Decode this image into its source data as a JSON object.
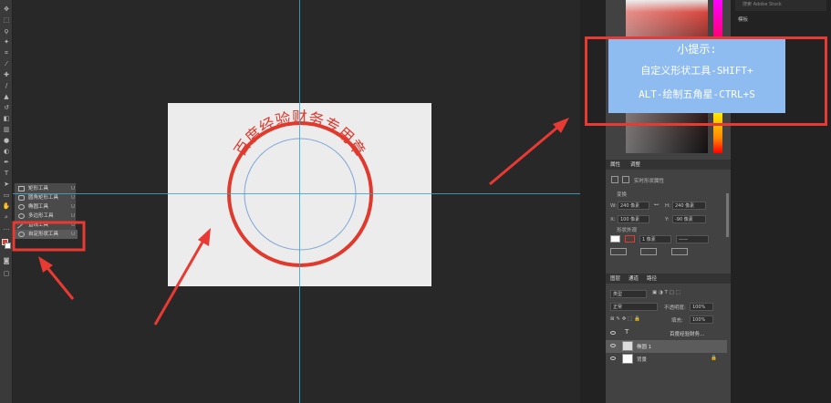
{
  "tip": {
    "title": "小提示:",
    "line1": "自定义形状工具-SHIFT+",
    "line2": "ALT-绘制五角星-CTRL+S"
  },
  "stamp": {
    "text": "百度经验财务专用章",
    "color": "#e03a2e"
  },
  "flyout": {
    "items": [
      {
        "label": "矩形工具",
        "shortcut": "U"
      },
      {
        "label": "圆角矩形工具",
        "shortcut": "U"
      },
      {
        "label": "椭圆工具",
        "shortcut": "U"
      },
      {
        "label": "多边形工具",
        "shortcut": "U"
      },
      {
        "label": "直线工具",
        "shortcut": "U"
      },
      {
        "label": "自定形状工具",
        "shortcut": "U"
      }
    ]
  },
  "colors": {
    "annotation_red": "#e83a32",
    "guide": "#3aa7c9",
    "tip_bg": "#8fbcf0"
  },
  "search": {
    "placeholder": "搜索 Adobe Stock"
  },
  "side": {
    "label": "模板"
  },
  "properties": {
    "tabs": [
      "属性",
      "调整"
    ],
    "shape_label": "实时形状属性",
    "section": "变换",
    "w_label": "W:",
    "w_value": "240 像素",
    "h_label": "H:",
    "h_value": "240 像素",
    "x_label": "X:",
    "x_value": "100 像素",
    "y_label": "Y:",
    "y_value": "-90 像素",
    "appearance": "形状外观",
    "stroke_size": "1 像素"
  },
  "layers": {
    "tabs": [
      "图层",
      "通道",
      "路径"
    ],
    "kind": "类型",
    "blend": "正常",
    "opacity_label": "不透明度:",
    "opacity": "100%",
    "fill_label": "填充:",
    "fill": "100%",
    "rows": [
      {
        "name": "百度经验财务...",
        "type": "text"
      },
      {
        "name": "椭圆 1",
        "type": "shape"
      },
      {
        "name": "背景",
        "type": "background"
      }
    ]
  }
}
